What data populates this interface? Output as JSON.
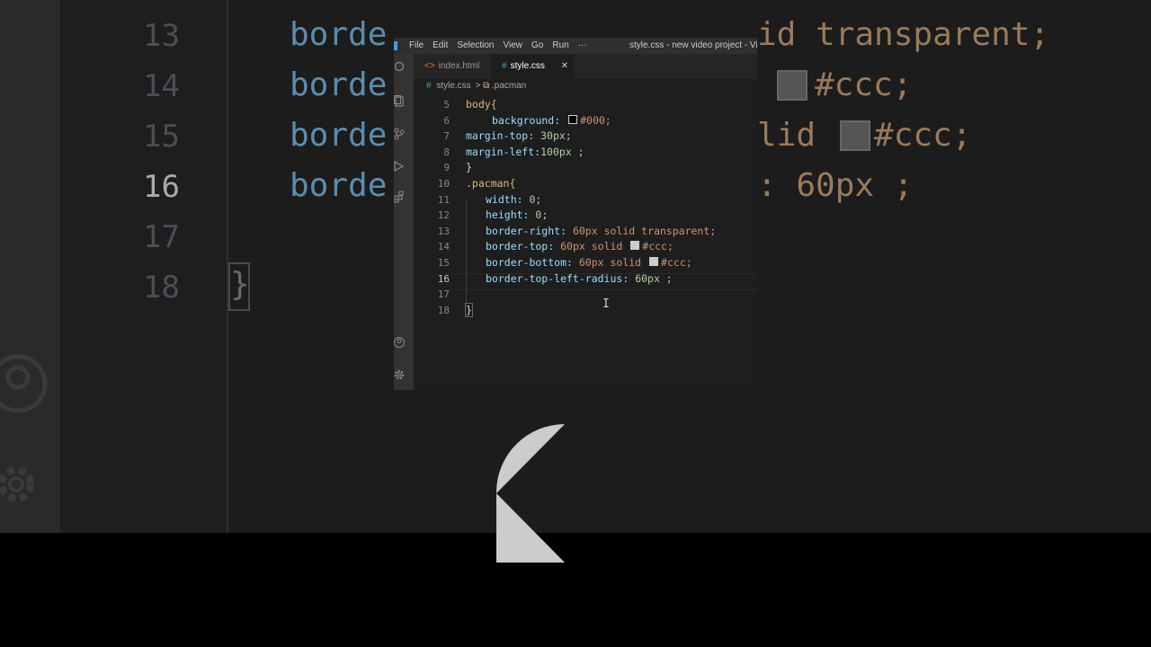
{
  "background_zoom": {
    "line_numbers": [
      "13",
      "14",
      "15",
      "16",
      "17",
      "18"
    ],
    "left_code": [
      "borde",
      "borde",
      "borde",
      "borde"
    ],
    "right_code": [
      "id transparent;",
      "#ccc;",
      "lid   #ccc;",
      ": 60px ;"
    ]
  },
  "window": {
    "title": "style.css - new video project - Visual",
    "menu": [
      "File",
      "Edit",
      "Selection",
      "View",
      "Go",
      "Run",
      "···"
    ]
  },
  "tabs": [
    {
      "icon": "<>",
      "label": "index.html"
    },
    {
      "icon": "#",
      "label": "style.css",
      "close": "✕"
    }
  ],
  "breadcrumb": {
    "file_icon": "#",
    "file": "style.css",
    "sep": ">",
    "symbol_icon": "⧉",
    "symbol": ".pacman"
  },
  "editor": {
    "active_line": "16",
    "lines": [
      {
        "n": "5",
        "text": "body{"
      },
      {
        "n": "6",
        "prop": "background:",
        "swatch": "#000000",
        "val": "#000;"
      },
      {
        "n": "7",
        "prop": "margin-top:",
        "val": "30px;"
      },
      {
        "n": "8",
        "prop": "margin-left:",
        "val": "100px ;"
      },
      {
        "n": "9",
        "text": "}"
      },
      {
        "n": "10",
        "text": ".pacman{"
      },
      {
        "n": "11",
        "prop": "width:",
        "val": "0;"
      },
      {
        "n": "12",
        "prop": "height:",
        "val": "0;"
      },
      {
        "n": "13",
        "prop": "border-right:",
        "val": "60px solid transparent;"
      },
      {
        "n": "14",
        "prop": "border-top:",
        "swatch": "#cccccc",
        "val": "60px solid #ccc;"
      },
      {
        "n": "15",
        "prop": "border-bottom:",
        "swatch": "#cccccc",
        "val": "60px solid #ccc;"
      },
      {
        "n": "16",
        "prop": "border-top-left-radius:",
        "val": "60px ;"
      },
      {
        "n": "17",
        "text": ""
      },
      {
        "n": "18",
        "text": "}"
      }
    ]
  },
  "colors": {
    "accent": "#3c9ee5",
    "editor_bg": "#1e1e1e",
    "shape": "#cccccc"
  }
}
